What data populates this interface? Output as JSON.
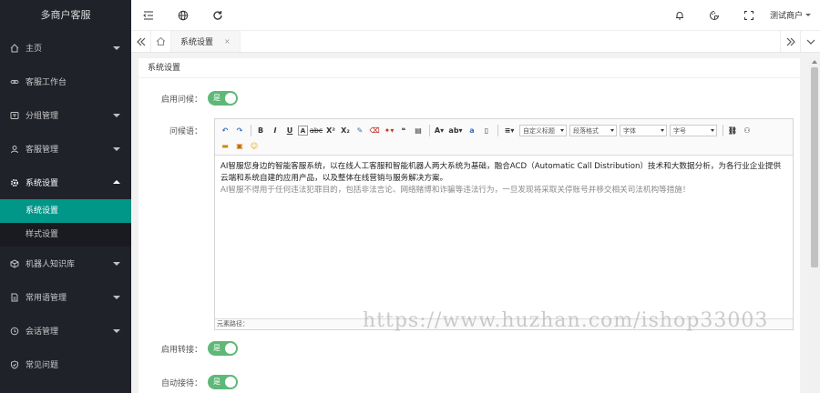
{
  "sidebar": {
    "logo": "多商户客服",
    "items": [
      {
        "label": "主页",
        "icon": "home-icon",
        "arrow": true
      },
      {
        "label": "客服工作台",
        "icon": "link-icon",
        "arrow": false
      },
      {
        "label": "分组管理",
        "icon": "group-icon",
        "arrow": true
      },
      {
        "label": "客服管理",
        "icon": "user-icon",
        "arrow": true
      },
      {
        "label": "系统设置",
        "icon": "gear-icon",
        "arrow": true,
        "expanded": true
      },
      {
        "label": "机器人知识库",
        "icon": "box-icon",
        "arrow": true
      },
      {
        "label": "常用语管理",
        "icon": "doc-icon",
        "arrow": true
      },
      {
        "label": "会话管理",
        "icon": "chat-icon",
        "arrow": true
      },
      {
        "label": "常见问题",
        "icon": "shield-icon",
        "arrow": false
      }
    ],
    "submenu": [
      {
        "label": "系统设置",
        "selected": true
      },
      {
        "label": "样式设置",
        "selected": false
      }
    ]
  },
  "header": {
    "user": "测试商户"
  },
  "tabs": {
    "current": "系统设置",
    "close": "×"
  },
  "content": {
    "card_title": "系统设置",
    "greeting_label": "启用问候：",
    "greeting_switch": "是",
    "message_label": "问候语：",
    "editor": {
      "selects": {
        "custom_title": "自定义标题",
        "paragraph": "段落格式",
        "font": "字体",
        "size": "字号"
      },
      "para1": "AI智服您身边的智能客服系统，以在线人工客服和智能机器人两大系统为基础，融合ACD（Automatic Call Distribution）技术和大数据分析，为各行业企业提供云端和系统自建的应用产品，以及整体在线营销与服务解决方案。",
      "para2": "AI智服不得用于任何违法犯罪目的，包括非法言论、网络赌博和诈骗等违法行为，一旦发现将采取关停账号并移交相关司法机构等措施！",
      "footer": "元素路径："
    },
    "transfer_label": "启用转接：",
    "transfer_switch": "是",
    "auto_label": "自动接待：",
    "auto_switch": "是"
  },
  "watermark": "https://www.huzhan.com/ishop33003"
}
